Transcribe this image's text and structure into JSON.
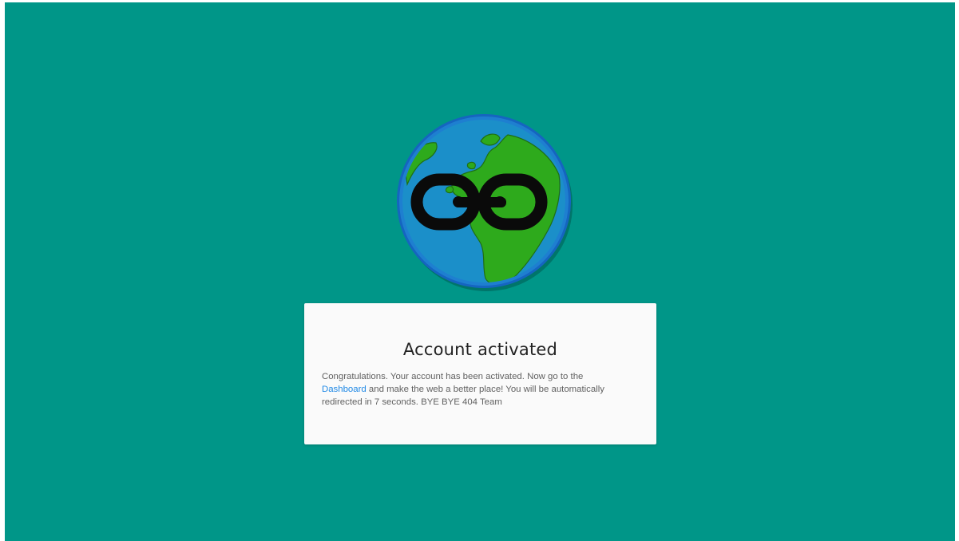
{
  "page": {
    "background_color": "#009688",
    "logo_icon": "broken-link-globe-icon"
  },
  "card": {
    "title": "Account activated",
    "message_before_link": "Congratulations. Your account has been activated. Now go to the ",
    "link_label": "Dashboard",
    "message_after_link": " and make the web a better place! You will be automatically redirected in 7 seconds. BYE BYE 404 Team",
    "link_color": "#1e88e5"
  }
}
